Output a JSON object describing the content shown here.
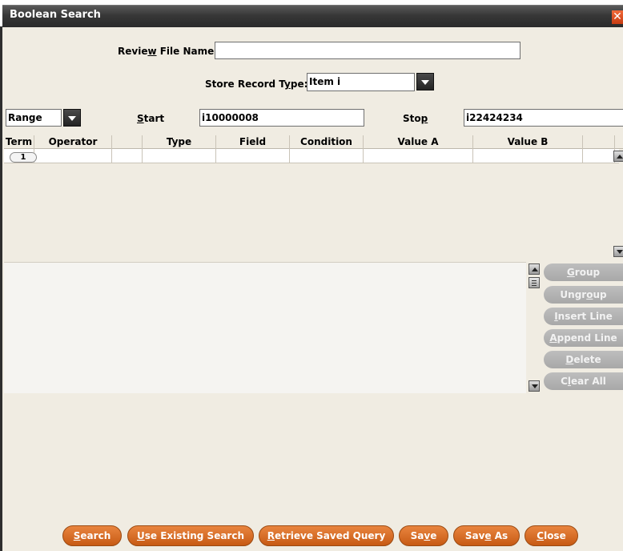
{
  "window": {
    "title": "Boolean Search",
    "close_glyph": "✕"
  },
  "form": {
    "review_file_label": "Review File Name:",
    "review_file_value": "",
    "store_record_label": "Store Record Type:",
    "store_record_value": "Item i",
    "range_value": "Range",
    "start_label": "Start",
    "start_value": "i10000008",
    "stop_label": "Stop",
    "stop_value": "i22424234"
  },
  "grid": {
    "columns": [
      "Term",
      "Operator",
      "",
      "Type",
      "Field",
      "Condition",
      "Value A",
      "Value B",
      ""
    ],
    "rows": [
      {
        "term": "1"
      }
    ]
  },
  "side_buttons": [
    "Group",
    "Ungroup",
    "Insert Line",
    "Append Line",
    "Delete",
    "Clear All"
  ],
  "bottom_buttons": [
    "Search",
    "Use Existing Search",
    "Retrieve Saved Query",
    "Save",
    "Save As",
    "Close"
  ],
  "colors": {
    "accent": "#d9702a",
    "disabled": "#b2b2b2",
    "titlebar": "#3a3a3a"
  }
}
